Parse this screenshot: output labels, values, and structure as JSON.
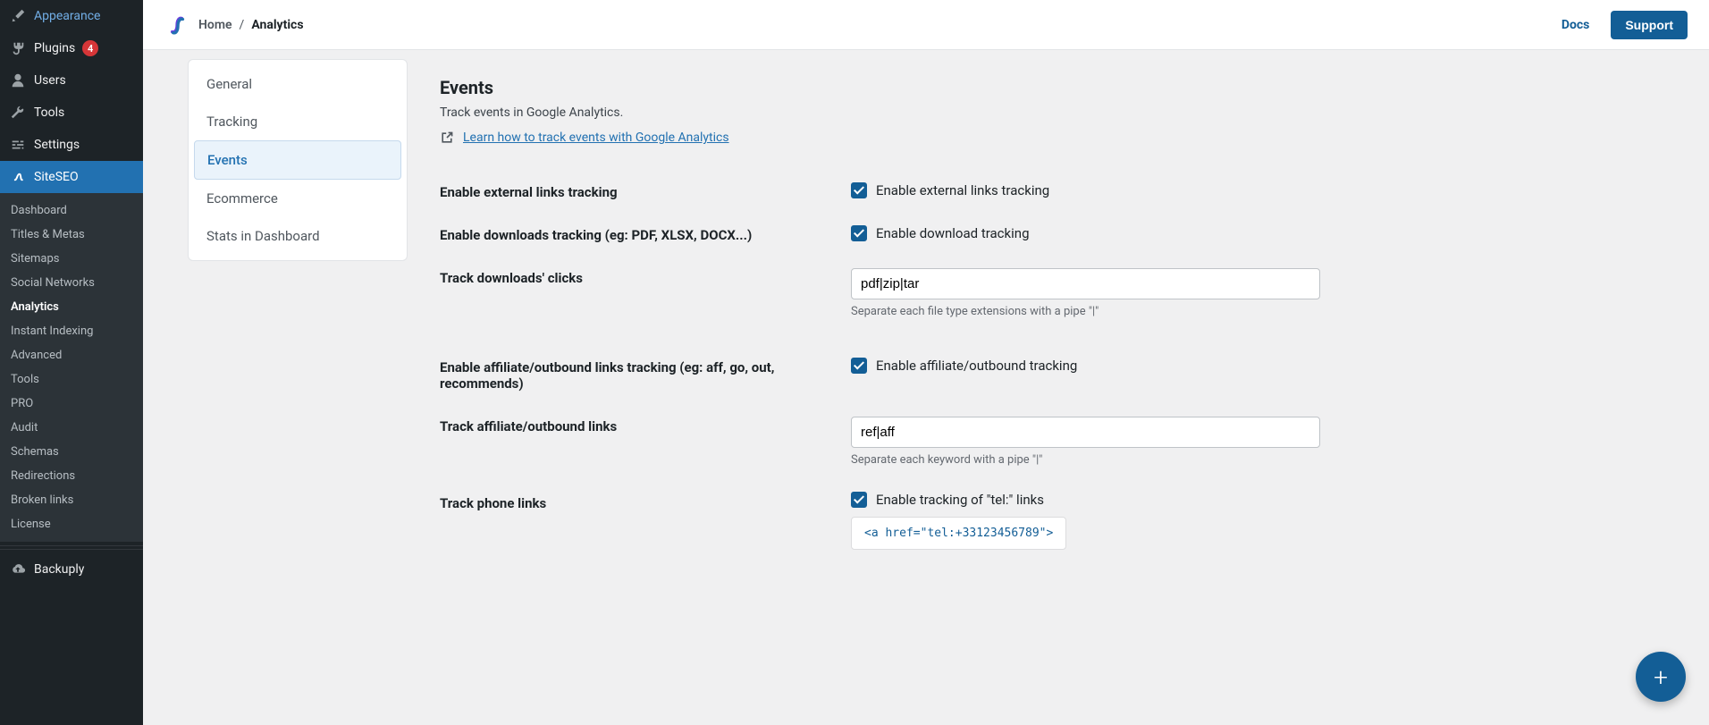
{
  "wp_menu": {
    "appearance": "Appearance",
    "plugins": "Plugins",
    "plugins_badge": "4",
    "users": "Users",
    "tools": "Tools",
    "settings": "Settings",
    "siteseo": "SiteSEO",
    "backuply": "Backuply"
  },
  "siteseo_submenu": {
    "dashboard": "Dashboard",
    "titles": "Titles & Metas",
    "sitemaps": "Sitemaps",
    "social": "Social Networks",
    "analytics": "Analytics",
    "indexing": "Instant Indexing",
    "advanced": "Advanced",
    "tools": "Tools",
    "pro": "PRO",
    "audit": "Audit",
    "schemas": "Schemas",
    "redirections": "Redirections",
    "broken": "Broken links",
    "license": "License"
  },
  "breadcrumb": {
    "home": "Home",
    "sep": "/",
    "current": "Analytics"
  },
  "header": {
    "docs": "Docs",
    "support": "Support"
  },
  "tabs": {
    "general": "General",
    "tracking": "Tracking",
    "events": "Events",
    "ecommerce": "Ecommerce",
    "stats": "Stats in Dashboard"
  },
  "panel": {
    "title": "Events",
    "desc": "Track events in Google Analytics.",
    "learn_link": "Learn how to track events with Google Analytics"
  },
  "fields": {
    "ext_links_label": "Enable external links tracking",
    "ext_links_cb": "Enable external links tracking",
    "downloads_label": "Enable downloads tracking (eg: PDF, XLSX, DOCX...)",
    "downloads_cb": "Enable download tracking",
    "track_dl_label": "Track downloads' clicks",
    "track_dl_value": "pdf|zip|tar",
    "track_dl_hint": "Separate each file type extensions with a pipe \"|\"",
    "affiliate_label": "Enable affiliate/outbound links tracking (eg: aff, go, out, recommends)",
    "affiliate_cb": "Enable affiliate/outbound tracking",
    "track_aff_label": "Track affiliate/outbound links",
    "track_aff_value": "ref|aff",
    "track_aff_hint": "Separate each keyword with a pipe \"|\"",
    "phone_label": "Track phone links",
    "phone_cb": "Enable tracking of \"tel:\" links",
    "phone_code": "<a href=\"tel:+33123456789\">"
  },
  "fab": "+"
}
